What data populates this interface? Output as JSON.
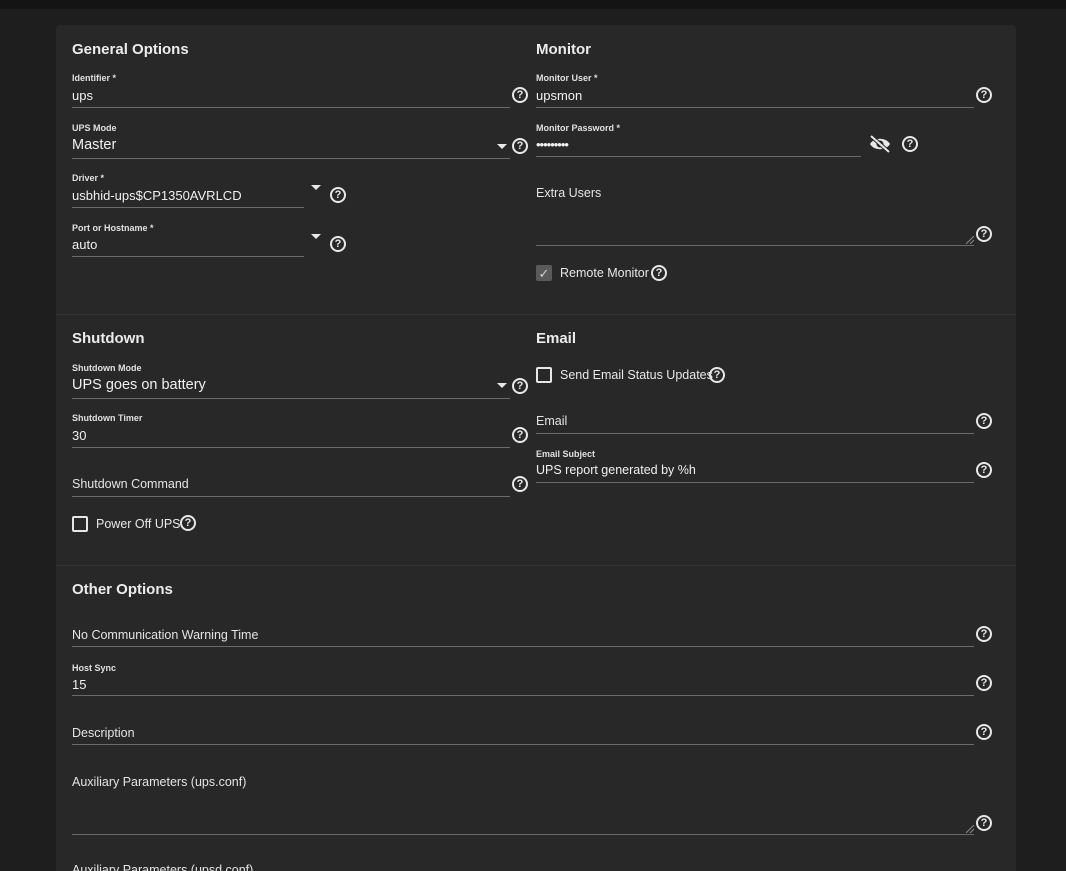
{
  "general": {
    "title": "General Options",
    "identifier": {
      "label": "Identifier *",
      "value": "ups"
    },
    "ups_mode": {
      "label": "UPS Mode",
      "value": "Master"
    },
    "driver": {
      "label": "Driver *",
      "value": "usbhid-ups$CP1350AVRLCD"
    },
    "port": {
      "label": "Port or Hostname *",
      "value": "auto"
    }
  },
  "monitor": {
    "title": "Monitor",
    "user": {
      "label": "Monitor User *",
      "value": "upsmon"
    },
    "password": {
      "label": "Monitor Password *",
      "value": "•••••••••"
    },
    "extra_users": {
      "label": "Extra Users"
    },
    "remote_monitor": {
      "label": "Remote Monitor",
      "checked": true
    }
  },
  "shutdown": {
    "title": "Shutdown",
    "mode": {
      "label": "Shutdown Mode",
      "value": "UPS goes on battery"
    },
    "timer": {
      "label": "Shutdown Timer",
      "value": "30"
    },
    "command": {
      "label": "Shutdown Command"
    },
    "power_off": {
      "label": "Power Off UPS",
      "checked": false
    }
  },
  "email": {
    "title": "Email",
    "send_updates": {
      "label": "Send Email Status Updates",
      "checked": false
    },
    "email": {
      "label": "Email"
    },
    "subject": {
      "label": "Email Subject",
      "value": "UPS report generated by %h"
    }
  },
  "other": {
    "title": "Other Options",
    "no_comm": {
      "label": "No Communication Warning Time"
    },
    "host_sync": {
      "label": "Host Sync",
      "value": "15"
    },
    "description": {
      "label": "Description"
    },
    "aux_ups": {
      "label": "Auxiliary Parameters (ups.conf)"
    },
    "aux_upsd": {
      "label": "Auxiliary Parameters (upsd.conf)"
    }
  },
  "icons": {
    "help": "help-circle-icon",
    "dropdown": "caret-down-icon",
    "visibility": "eye-off-icon",
    "check": "check-icon"
  },
  "help_glyph": "?",
  "colors": {
    "background": "#1e1e1e",
    "card": "#282828",
    "text": "#e6e6e6",
    "underline": "#6a6a6a"
  }
}
